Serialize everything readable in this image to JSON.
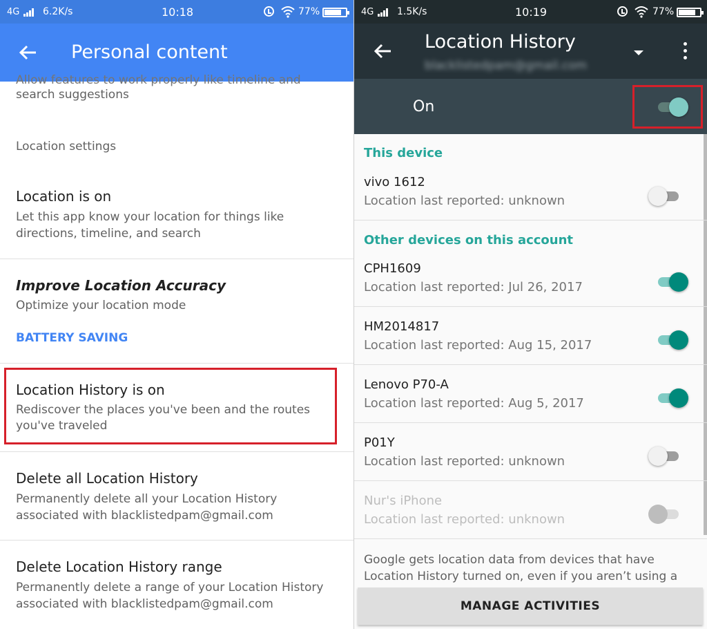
{
  "left": {
    "status": {
      "network": "4G",
      "speed": "6.2K/s",
      "time": "10:18",
      "battery": "77%"
    },
    "header": {
      "title": "Personal content"
    },
    "items": [
      {
        "line1": "Allow features to work properly like timeline and",
        "line2": "search suggestions"
      },
      {
        "heading": "Location settings"
      },
      {
        "title": "Location is on",
        "desc1": "Let this app know your location for things like",
        "desc2": "directions, timeline, and search"
      },
      {
        "title": "Improve Location Accuracy",
        "desc": "Optimize your location mode",
        "action": "BATTERY SAVING"
      },
      {
        "title": "Location History is on",
        "desc1": "Rediscover the places you've been and the routes",
        "desc2": "you've traveled"
      },
      {
        "title": "Delete all Location History",
        "desc1": "Permanently delete all your Location History",
        "desc2": "associated with blacklistedpam@gmail.com"
      },
      {
        "title": "Delete Location History range",
        "desc1": "Permanently delete a range of your Location History",
        "desc2": "associated with blacklistedpam@gmail.com"
      }
    ]
  },
  "right": {
    "status": {
      "network": "4G",
      "speed": "1.5K/s",
      "time": "10:19",
      "battery": "77%"
    },
    "header": {
      "title": "Location History",
      "account": "blacklistedpam@gmail.com"
    },
    "master": {
      "label": "On",
      "on": true
    },
    "this_device": {
      "heading": "This device",
      "devices": [
        {
          "name": "vivo 1612",
          "reported": "Location last reported: unknown",
          "on": false
        }
      ]
    },
    "other_devices": {
      "heading": "Other devices on this account",
      "devices": [
        {
          "name": "CPH1609",
          "reported": "Location last reported: Jul 26, 2017",
          "on": true
        },
        {
          "name": "HM2014817",
          "reported": "Location last reported: Aug 15, 2017",
          "on": true
        },
        {
          "name": "Lenovo P70-A",
          "reported": "Location last reported: Aug 5, 2017",
          "on": true
        },
        {
          "name": "P01Y",
          "reported": "Location last reported: unknown",
          "on": false
        },
        {
          "name": "Nur's iPhone",
          "reported": "Location last reported: unknown",
          "on": false,
          "disabled": true
        }
      ]
    },
    "footer": {
      "text": "Google gets location data from devices that have Location History turned on, even if you aren’t using a",
      "button": "MANAGE ACTIVITIES"
    }
  },
  "colors": {
    "left_header": "#4285f4",
    "right_header": "#263238",
    "accent_teal": "#26a69a",
    "link_blue": "#4285f4",
    "highlight_red": "#d6202a"
  },
  "icons": [
    "back-arrow-icon",
    "signal-icon",
    "alarm-icon",
    "wifi-icon",
    "battery-icon",
    "dropdown-icon",
    "more-vert-icon"
  ]
}
